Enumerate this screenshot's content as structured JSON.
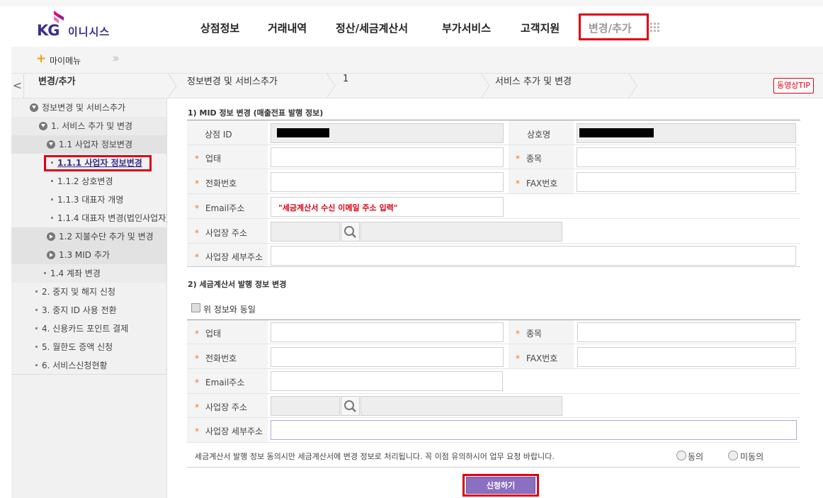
{
  "brand": {
    "kg": "KG",
    "name": "이니시스"
  },
  "gnb": [
    {
      "label": "상점정보"
    },
    {
      "label": "거래내역"
    },
    {
      "label": "정산/세금계산서"
    },
    {
      "label": "부가서비스"
    },
    {
      "label": "고객지원"
    },
    {
      "label": "변경/추가",
      "active": true
    }
  ],
  "mymenu": {
    "label": "마이메뉴",
    "plus": "+"
  },
  "breadcrumb": {
    "back": "<",
    "items": [
      "변경/추가",
      "정보변경 및 서비스추가",
      "1",
      "서비스 추가 및 변경"
    ],
    "tip": "동영상TIP"
  },
  "sidebar": {
    "items": [
      {
        "label": "정보변경 및 서비스추가",
        "icon": "chevron-down-circle-icon"
      },
      {
        "label": "1. 서비스 추가 및 변경",
        "icon": "chevron-down-circle-icon"
      },
      {
        "label": "1.1 사업자 정보변경",
        "icon": "chevron-down-circle-icon"
      },
      {
        "label": "1.1.1 사업자 정보변경",
        "selected": true
      },
      {
        "label": "1.1.2 상호변경"
      },
      {
        "label": "1.1.3 대표자 개명"
      },
      {
        "label": "1.1.4 대표자 변경(법인사업자)"
      },
      {
        "label": "1.2 지불수단 추가 및 변경",
        "icon": "chevron-right-circle-icon"
      },
      {
        "label": "1.3 MID 추가",
        "icon": "chevron-right-circle-icon"
      },
      {
        "label": "1.4 계좌 변경"
      },
      {
        "label": "2. 중지 및 해지 신청"
      },
      {
        "label": "3. 중지 ID 사용 전환"
      },
      {
        "label": "4. 신용카드 포인트 결제"
      },
      {
        "label": "5. 월한도 증액 신청"
      },
      {
        "label": "6. 서비스신청현황"
      }
    ]
  },
  "section1": {
    "title": "1) MID 정보 변경 (매출전표 발행 정보)",
    "shop_id_label": "상점 ID",
    "company_name_label": "상호명",
    "business_type_label": "업태",
    "business_item_label": "종목",
    "phone_label": "전화번호",
    "fax_label": "FAX번호",
    "email_label": "Email주소",
    "email_note": "\"세금계산서 수신 이메일 주소 입력\"",
    "address_label": "사업장 주소",
    "address_detail_label": "사업장 세부주소",
    "required_mark": "*"
  },
  "section2": {
    "title": "2) 세금계산서 발행 정보 변경",
    "same_as_above": "위 정보와 동일",
    "business_type_label": "업태",
    "business_item_label": "종목",
    "phone_label": "전화번호",
    "fax_label": "FAX번호",
    "email_label": "Email주소",
    "address_label": "사업장 주소",
    "address_detail_label": "사업장 세부주소",
    "notice": "세금계산서 발행 정보 동의시만 세금계산서에 변경 정보로 처리됩니다. 꼭 이점 유의하시어 업무 요청 바랍니다.",
    "agree": "동의",
    "disagree": "미동의"
  },
  "apply_button": "신청하기",
  "colors": {
    "brand": "#3a2e8c",
    "highlight": "#e00012",
    "button": "#8b6fc0",
    "required": "#f07820"
  }
}
